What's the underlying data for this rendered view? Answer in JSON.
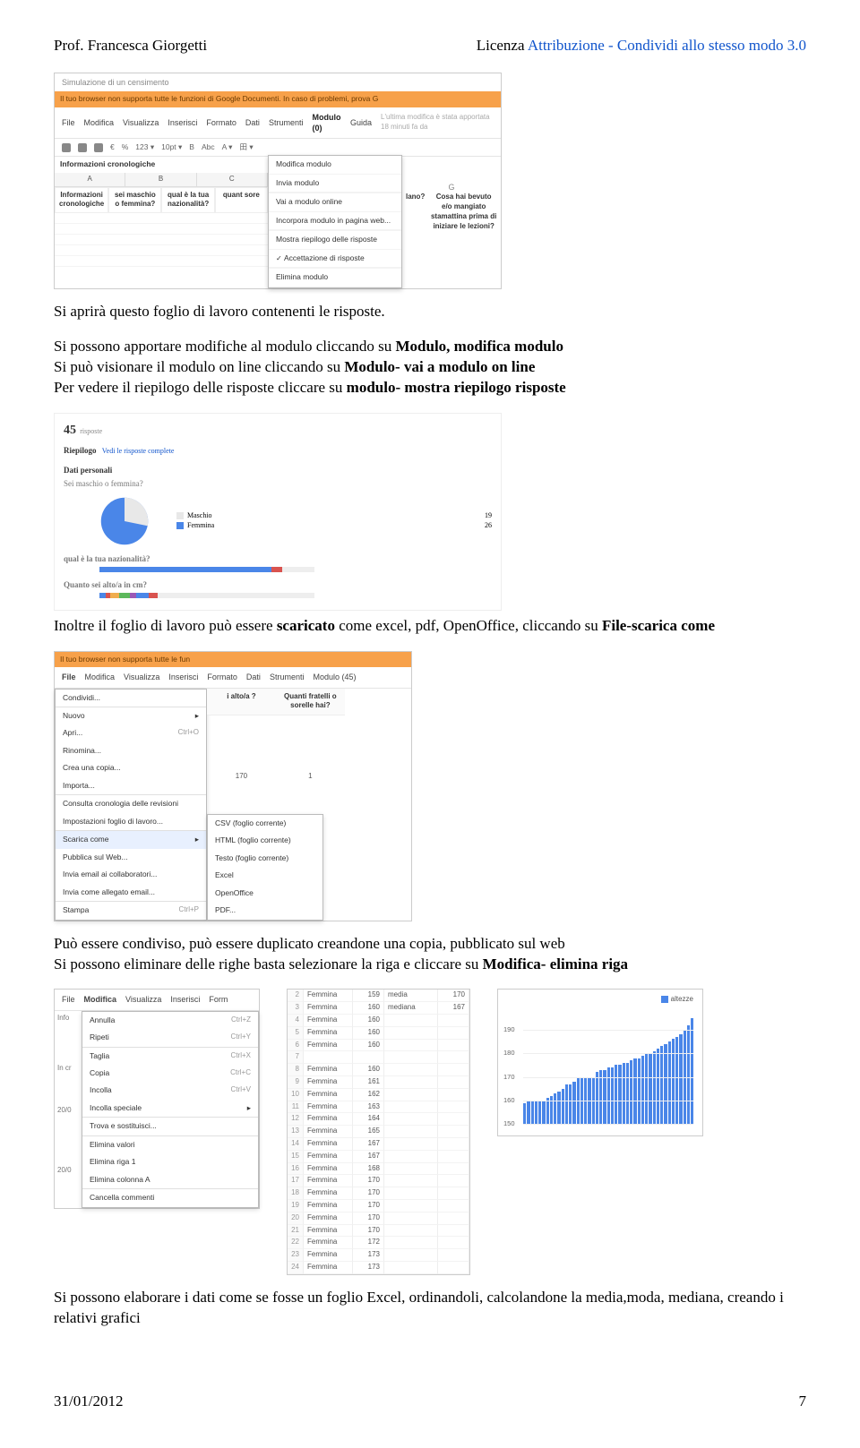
{
  "header": {
    "left": "Prof. Francesca Giorgetti",
    "right_prefix": "Licenza ",
    "right_link": "Attribuzione - Condividi allo stesso modo 3.0"
  },
  "para1": "Si aprirà questo foglio di lavoro contenenti le risposte.",
  "para2": {
    "l1_a": "Si possono apportare modifiche al modulo cliccando su ",
    "l1_b": "Modulo, modifica modulo",
    "l2_a": "Si può visionare il modulo on line cliccando su ",
    "l2_b": "Modulo- vai a modulo on line",
    "l3_a": "Per vedere il riepilogo delle risposte cliccare su ",
    "l3_b": "modulo- mostra riepilogo risposte"
  },
  "para3": {
    "a": "Inoltre il foglio di lavoro può essere ",
    "b": "scaricato",
    "c": " come excel, pdf, OpenOffice, cliccando su ",
    "d": "File-scarica come"
  },
  "para4": {
    "l1": "Può essere condiviso, può essere duplicato creandone una copia, pubblicato sul web",
    "l2_a": "Si possono eliminare delle righe basta selezionare la riga e cliccare su ",
    "l2_b": "Modifica- elimina riga"
  },
  "para5": "Si possono elaborare i dati come se fosse un foglio Excel, ordinandoli, calcolandone la media,moda, mediana, creando i relativi grafici",
  "footer": {
    "date": "31/01/2012",
    "page": "7"
  },
  "ss1": {
    "doc_title": "Simulazione di un censimento",
    "orange_bar": "Il tuo browser non supporta tutte le funzioni di Google Documenti. In caso di problemi, prova G",
    "menubar": [
      "File",
      "Modifica",
      "Visualizza",
      "Inserisci",
      "Formato",
      "Dati",
      "Strumenti",
      "Modulo (0)",
      "Guida"
    ],
    "menu_note": "L'ultima modifica è stata apportata 18 minuti fa da",
    "toolbar": [
      "€",
      "%",
      "123 ▾",
      "10pt ▾",
      "B",
      "Abc",
      "A ▾",
      "田 ▾"
    ],
    "section_title": "Informazioni cronologiche",
    "col_letters": [
      "A",
      "B",
      "C"
    ],
    "right_letter": "G",
    "questions": [
      "Informazioni cronologiche",
      "sei maschio o femmina?",
      "qual è la tua nazionalità?",
      "quant sore"
    ],
    "right_question_labels": [
      "lano?",
      "Cosa hai bevuto e/o mangiato stamattina prima di iniziare le lezioni?"
    ],
    "dropdown": [
      "Modifica modulo",
      "Invia modulo",
      "__sep",
      "Vai a modulo online",
      "Incorpora modulo in pagina web...",
      "__sep",
      "Mostra riepilogo delle risposte",
      "Accettazione di risposte",
      "__sep",
      "Elimina modulo"
    ],
    "dropdown_checked_index": 7
  },
  "riepilogo": {
    "n": "45",
    "n_label": "risposte",
    "title": "Riepilogo",
    "title_link": "Vedi le risposte complete",
    "section1": "Dati personali",
    "q1": "Sei maschio o femmina?",
    "legend": [
      {
        "label": "Maschio",
        "count": "19",
        "color": "#e8e8e8"
      },
      {
        "label": "Femmina",
        "count": "26",
        "color": "#4a86e8"
      }
    ],
    "q2": "qual è la tua nazionalità?",
    "q3": "Quanto sei alto/a in cm?"
  },
  "ss2": {
    "orange_bar": "Il tuo browser non supporta tutte le fun",
    "menubar": [
      "File",
      "Modifica",
      "Visualizza",
      "Inserisci",
      "Formato",
      "Dati",
      "Strumenti",
      "Modulo (45)"
    ],
    "right_cols": [
      "i alto/a ?",
      "Quanti fratelli o sorelle hai?"
    ],
    "right_vals": [
      "170",
      "1"
    ],
    "file_menu": [
      {
        "label": "Condividi..."
      },
      {
        "sep": true
      },
      {
        "label": "Nuovo",
        "arrow": true
      },
      {
        "label": "Apri...",
        "shortcut": "Ctrl+O"
      },
      {
        "label": "Rinomina..."
      },
      {
        "label": "Crea una copia..."
      },
      {
        "label": "Importa..."
      },
      {
        "sep": true
      },
      {
        "label": "Consulta cronologia delle revisioni"
      },
      {
        "label": "Impostazioni foglio di lavoro..."
      },
      {
        "sep": true
      },
      {
        "label": "Scarica come",
        "arrow": true,
        "highlight": true
      },
      {
        "label": "Pubblica sul Web..."
      },
      {
        "label": "Invia email ai collaboratori..."
      },
      {
        "label": "Invia come allegato email..."
      },
      {
        "sep": true
      },
      {
        "label": "Stampa",
        "shortcut": "Ctrl+P"
      }
    ],
    "submenu": [
      "CSV (foglio corrente)",
      "HTML (foglio corrente)",
      "Testo (foglio corrente)",
      "Excel",
      "OpenOffice",
      "PDF..."
    ]
  },
  "ss4": {
    "menubar": [
      "File",
      "Modifica",
      "Visualizza",
      "Inserisci",
      "Form"
    ],
    "dropdown": [
      {
        "label": "Annulla",
        "shortcut": "Ctrl+Z"
      },
      {
        "label": "Ripeti",
        "shortcut": "Ctrl+Y"
      },
      {
        "sep": true
      },
      {
        "label": "Taglia",
        "shortcut": "Ctrl+X"
      },
      {
        "label": "Copia",
        "shortcut": "Ctrl+C"
      },
      {
        "label": "Incolla",
        "shortcut": "Ctrl+V"
      },
      {
        "label": "Incolla speciale",
        "arrow": true
      },
      {
        "sep": true
      },
      {
        "label": "Trova e sostituisci..."
      },
      {
        "sep": true
      },
      {
        "label": "Elimina valori"
      },
      {
        "label": "Elimina riga 1"
      },
      {
        "label": "Elimina colonna A"
      },
      {
        "sep": true
      },
      {
        "label": "Cancella commenti"
      }
    ],
    "side_labels": [
      "Info",
      "In cr",
      "20/0",
      "20/0"
    ]
  },
  "ss5_table": {
    "rows": [
      [
        "2",
        "Femmina",
        "159",
        "media",
        "170"
      ],
      [
        "3",
        "Femmina",
        "160",
        "mediana",
        "167"
      ],
      [
        "4",
        "Femmina",
        "160",
        "",
        ""
      ],
      [
        "5",
        "Femmina",
        "160",
        "",
        ""
      ],
      [
        "6",
        "Femmina",
        "160",
        "",
        ""
      ],
      [
        "7",
        "",
        "",
        "",
        ""
      ],
      [
        "8",
        "Femmina",
        "160",
        "",
        ""
      ],
      [
        "9",
        "Femmina",
        "161",
        "",
        ""
      ],
      [
        "10",
        "Femmina",
        "162",
        "",
        ""
      ],
      [
        "11",
        "Femmina",
        "163",
        "",
        ""
      ],
      [
        "12",
        "Femmina",
        "164",
        "",
        ""
      ],
      [
        "13",
        "Femmina",
        "165",
        "",
        ""
      ],
      [
        "14",
        "Femmina",
        "167",
        "",
        ""
      ],
      [
        "15",
        "Femmina",
        "167",
        "",
        ""
      ],
      [
        "16",
        "Femmina",
        "168",
        "",
        ""
      ],
      [
        "17",
        "Femmina",
        "170",
        "",
        ""
      ],
      [
        "18",
        "Femmina",
        "170",
        "",
        ""
      ],
      [
        "19",
        "Femmina",
        "170",
        "",
        ""
      ],
      [
        "20",
        "Femmina",
        "170",
        "",
        ""
      ],
      [
        "21",
        "Femmina",
        "170",
        "",
        ""
      ],
      [
        "22",
        "Femmina",
        "172",
        "",
        ""
      ],
      [
        "23",
        "Femmina",
        "173",
        "",
        ""
      ],
      [
        "24",
        "Femmina",
        "173",
        "",
        ""
      ]
    ]
  },
  "chart_data": {
    "type": "bar",
    "title": "altezze",
    "ylabel": "",
    "ylim": [
      150,
      200
    ],
    "yticks": [
      150,
      160,
      170,
      180,
      190
    ],
    "categories_note": "row index 2–46 (unlabeled on x-axis)",
    "values": [
      159,
      160,
      160,
      160,
      160,
      160,
      161,
      162,
      163,
      164,
      165,
      167,
      167,
      168,
      170,
      170,
      170,
      170,
      170,
      172,
      173,
      173,
      174,
      174,
      175,
      175,
      176,
      176,
      177,
      178,
      178,
      179,
      180,
      180,
      181,
      182,
      183,
      184,
      185,
      186,
      187,
      188,
      190,
      192,
      195
    ],
    "series_color": "#4a86e8"
  }
}
